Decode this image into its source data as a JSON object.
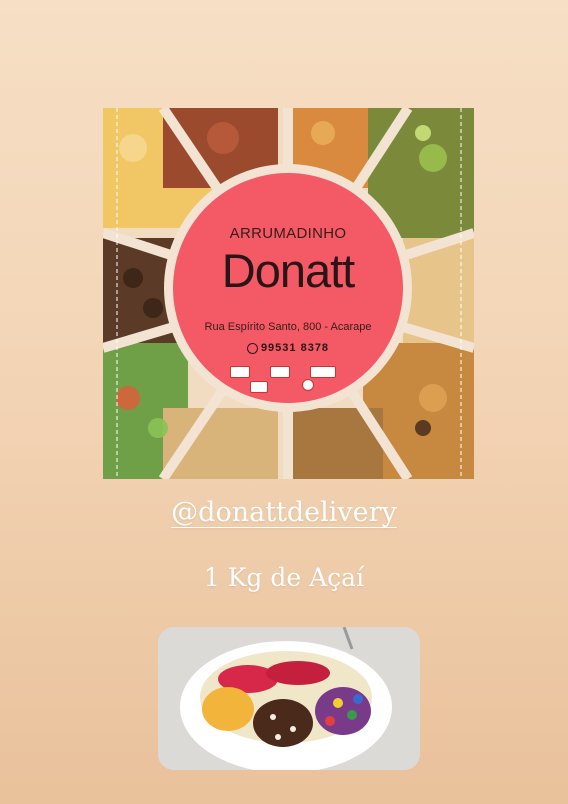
{
  "menu_card": {
    "subtitle": "ARRUMADINHO",
    "brand_name": "Donatt",
    "address": "Rua Espírito Santo, 800 - Acarape",
    "phone": "99531 8378",
    "icons": [
      "whatsapp-icon",
      "payment-card-icons"
    ]
  },
  "handle": "@donattdelivery",
  "caption": "1 Kg de Açaí",
  "colors": {
    "logo_circle": "#f45a66",
    "background_top": "#f6dfc5",
    "background_bottom": "#e9c19b"
  }
}
